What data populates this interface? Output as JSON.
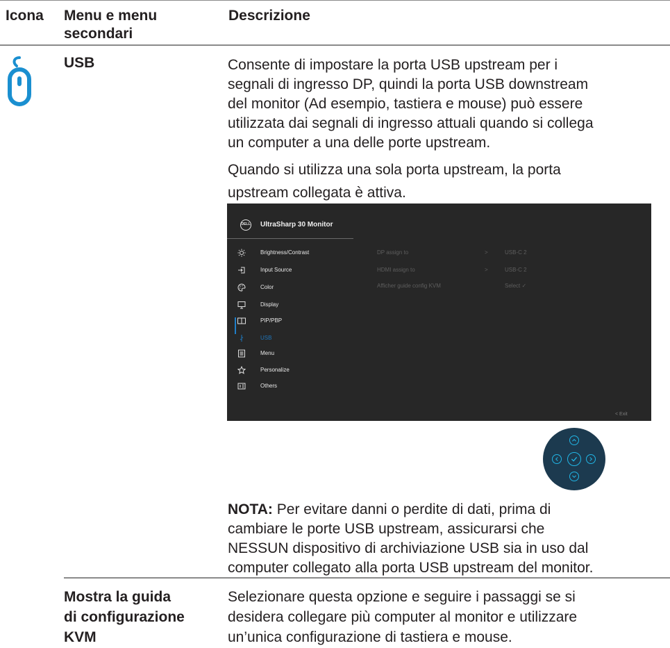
{
  "table": {
    "headers": {
      "icon": "Icona",
      "menu_line1": "Menu e menu",
      "menu_line2": "secondari",
      "description": "Descrizione"
    },
    "usb_row": {
      "icon": "usb-mouse-icon",
      "menu_name": "USB",
      "para1": [
        "Consente di impostare la porta USB upstream per i",
        "segnali di ingresso DP, quindi la porta USB downstream",
        "del monitor (Ad esempio, tastiera e mouse) può essere",
        "utilizzata dai segnali di ingresso attuali quando si collega",
        "un computer a una delle porte  upstream."
      ],
      "para2": [
        "Quando si utilizza una sola porta upstream, la porta",
        "upstream collegata è attiva."
      ],
      "note_label": "NOTA:",
      "note_first": " Per evitare danni o perdite di dati, prima di",
      "note_rest": [
        "cambiare le porte USB upstream, assicurarsi che",
        "NESSUN dispositivo di archiviazione USB sia in uso dal",
        "computer collegato alla porta USB upstream del monitor."
      ]
    },
    "kvm_row": {
      "menu_name": [
        "Mostra la guida",
        "di configurazione",
        "KVM"
      ],
      "description": [
        "Selezionare questa opzione e seguire i passaggi se si",
        "desidera collegare più computer al monitor e utilizzare",
        "un’unica configurazione di tastiera e mouse."
      ]
    }
  },
  "osd": {
    "logo": "DELL",
    "title": "UltraSharp 30 Monitor",
    "menu_items": [
      {
        "label": "Brightness/Contrast",
        "icon": "brightness-icon"
      },
      {
        "label": "Input Source",
        "icon": "input-source-icon"
      },
      {
        "label": "Color",
        "icon": "color-palette-icon"
      },
      {
        "label": "Display",
        "icon": "display-icon"
      },
      {
        "label": "PIP/PBP",
        "icon": "pip-pbp-icon"
      },
      {
        "label": "USB",
        "icon": "usb-icon",
        "active": true
      },
      {
        "label": "Menu",
        "icon": "menu-icon"
      },
      {
        "label": "Personalize",
        "icon": "star-icon"
      },
      {
        "label": "Others",
        "icon": "others-icon"
      }
    ],
    "settings": [
      {
        "label": "DP assign to",
        "arrow": ">",
        "value": "USB-C 2"
      },
      {
        "label": "HDMI assign to",
        "arrow": ">",
        "value": "USB-C 2"
      },
      {
        "label": "Afficher guide config KVM",
        "value": "Select ✓"
      }
    ],
    "exit": "<  Exit",
    "colors": {
      "background": "#272727",
      "accent": "#1f7ec8",
      "text": "#e8e8e8",
      "dim": "#5e5e5e"
    }
  },
  "joystick": {
    "buttons": [
      "up-arrow-icon",
      "left-arrow-icon",
      "check-icon",
      "right-arrow-icon",
      "down-arrow-icon"
    ],
    "colors": {
      "body": "#1c3a4f",
      "ring": "#21b6e6"
    }
  }
}
